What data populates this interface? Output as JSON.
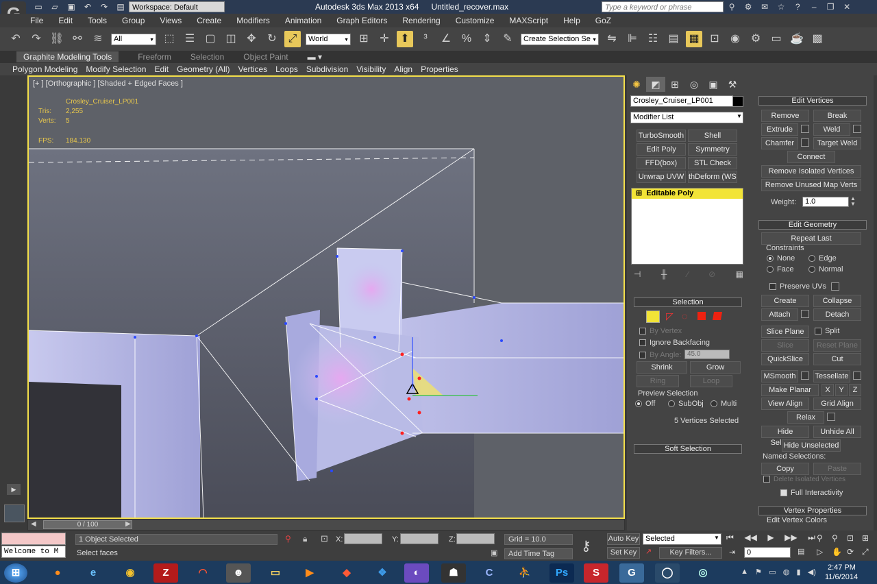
{
  "titlebar": {
    "workspace": "Workspace: Default",
    "app_title": "Autodesk 3ds Max  2013 x64",
    "file_title": "Untitled_recover.max",
    "search_placeholder": "Type a keyword or phrase"
  },
  "menu": [
    "File",
    "Edit",
    "Tools",
    "Group",
    "Views",
    "Create",
    "Modifiers",
    "Animation",
    "Graph Editors",
    "Rendering",
    "Customize",
    "MAXScript",
    "Help",
    "GoZ"
  ],
  "toolbar": {
    "filter": "All",
    "coord": "World",
    "named_sel": "Create Selection Se"
  },
  "ribbon_tabs": [
    "Graphite Modeling Tools",
    "Freeform",
    "Selection",
    "Object Paint"
  ],
  "ribbon_items": [
    "Polygon Modeling",
    "Modify Selection",
    "Edit",
    "Geometry (All)",
    "Vertices",
    "Loops",
    "Subdivision",
    "Visibility",
    "Align",
    "Properties"
  ],
  "viewport": {
    "label": "[+ ] [Orthographic ] [Shaded + Edged Faces ]",
    "obj_name": "Crosley_Cruiser_LP001",
    "tris_label": "Tris:",
    "tris": "2,255",
    "verts_label": "Verts:",
    "verts": "5",
    "fps_label": "FPS:",
    "fps": "184.130",
    "time": "0 / 100"
  },
  "cmd": {
    "obj_name": "Crosley_Cruiser_LP001",
    "modifier_list": "Modifier List",
    "modbuttons": [
      "TurboSmooth",
      "Shell",
      "Edit Poly",
      "Symmetry",
      "FFD(box)",
      "STL Check",
      "Unwrap UVW",
      "thDeform (WSI"
    ],
    "stack_item": "Editable Poly",
    "selection": {
      "title": "Selection",
      "by_vertex": "By Vertex",
      "ignore_backfacing": "Ignore Backfacing",
      "by_angle": "By Angle:",
      "angle": "45.0",
      "shrink": "Shrink",
      "grow": "Grow",
      "ring": "Ring",
      "loop": "Loop",
      "preview": "Preview Selection",
      "off": "Off",
      "subobj": "SubObj",
      "multi": "Multi",
      "selected_count": "5 Vertices Selected"
    },
    "soft_selection": "Soft Selection",
    "edit_vertices": {
      "title": "Edit Vertices",
      "remove": "Remove",
      "break": "Break",
      "extrude": "Extrude",
      "weld": "Weld",
      "chamfer": "Chamfer",
      "target_weld": "Target Weld",
      "connect": "Connect",
      "remove_isolated": "Remove Isolated Vertices",
      "remove_unused": "Remove Unused Map Verts",
      "weight_label": "Weight:",
      "weight": "1.0"
    },
    "edit_geometry": {
      "title": "Edit Geometry",
      "repeat_last": "Repeat Last",
      "constraints": "Constraints",
      "none": "None",
      "edge": "Edge",
      "face": "Face",
      "normal": "Normal",
      "preserve_uvs": "Preserve UVs",
      "create": "Create",
      "collapse": "Collapse",
      "attach": "Attach",
      "detach": "Detach",
      "slice_plane": "Slice Plane",
      "split": "Split",
      "slice": "Slice",
      "reset_plane": "Reset Plane",
      "quickslice": "QuickSlice",
      "cut": "Cut",
      "msmooth": "MSmooth",
      "tessellate": "Tessellate",
      "make_planar": "Make Planar",
      "x": "X",
      "y": "Y",
      "z": "Z",
      "view_align": "View Align",
      "grid_align": "Grid Align",
      "relax": "Relax",
      "hide_selected": "Hide Selected",
      "unhide_all": "Unhide All",
      "hide_unselected": "Hide Unselected",
      "named_selections": "Named Selections:",
      "copy": "Copy",
      "paste": "Paste",
      "delete_isolated": "Delete Isolated Vertices",
      "full_interactivity": "Full Interactivity"
    },
    "vertex_properties": "Vertex Properties",
    "edit_vertex_colors": "Edit Vertex Colors"
  },
  "status": {
    "welcome": "Welcome to M",
    "objects_selected": "1 Object Selected",
    "prompt": "Select faces",
    "x_label": "X:",
    "y_label": "Y:",
    "z_label": "Z:",
    "grid": "Grid = 10.0",
    "add_time_tag": "Add Time Tag",
    "auto_key": "Auto Key",
    "set_key": "Set Key",
    "key_mode": "Selected",
    "key_filters": "Key Filters...",
    "frame": "0"
  },
  "taskbar": {
    "time": "2:47 PM",
    "date": "11/6/2014"
  },
  "colors": {
    "viewport_border": "#f4e04a",
    "stat_text": "#e8c74c",
    "stack_active": "#f2e437",
    "taskbar": "#1c3b5e"
  }
}
